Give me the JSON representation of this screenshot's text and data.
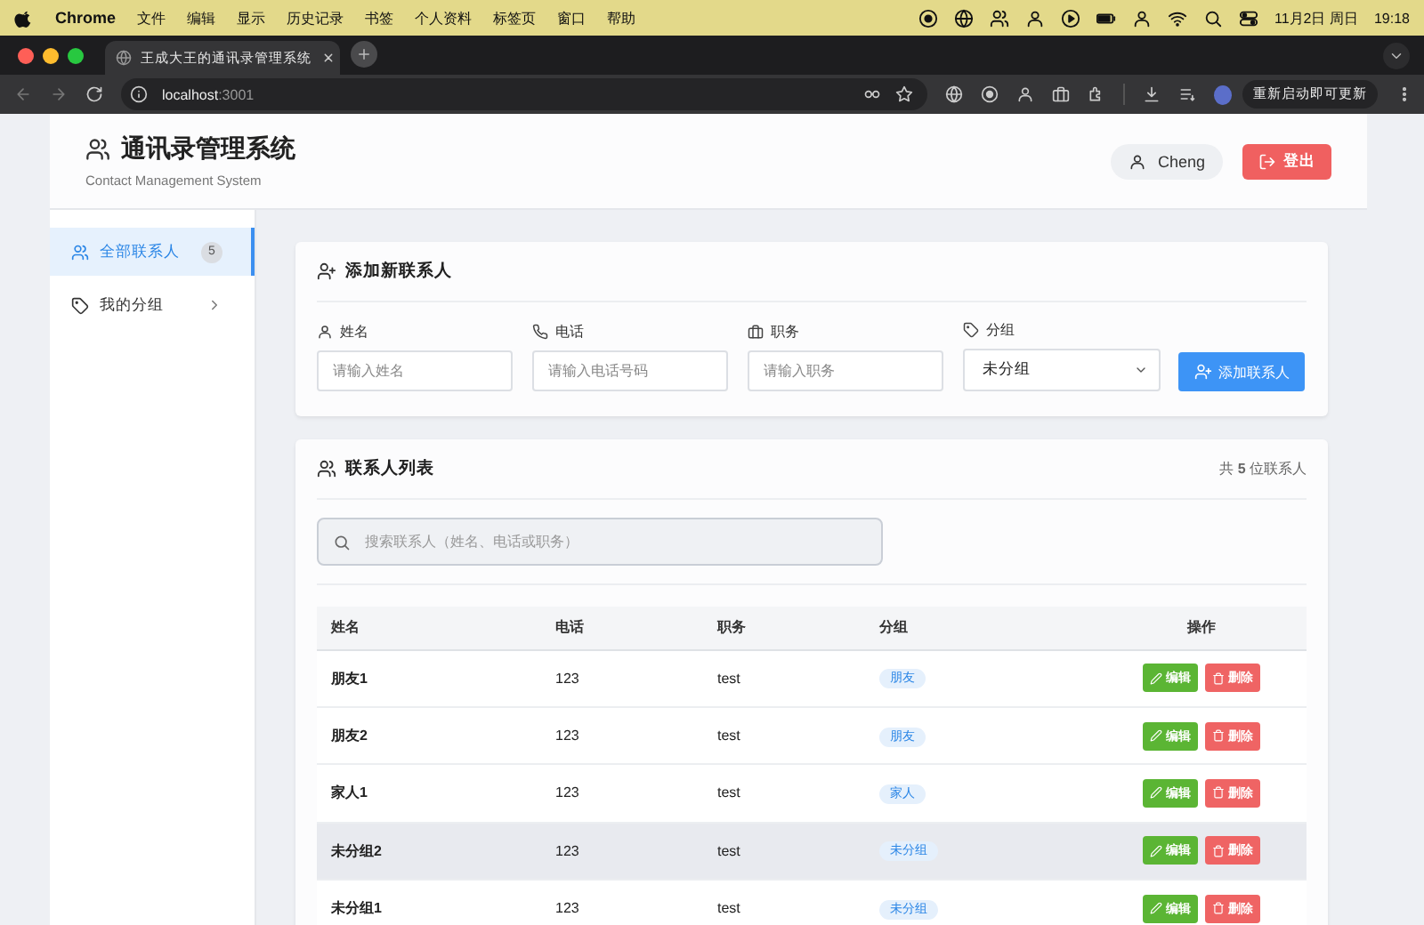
{
  "menu_bar": {
    "app": "Chrome",
    "items": [
      "文件",
      "编辑",
      "显示",
      "历史记录",
      "书签",
      "个人资料",
      "标签页",
      "窗口",
      "帮助"
    ],
    "date": "11月2日 周日",
    "time": "19:18"
  },
  "browser": {
    "tab_title": "王成大王的通讯录管理系统",
    "url_host": "localhost",
    "url_port": ":3001",
    "update_button": "重新启动即可更新"
  },
  "header": {
    "title": "通讯录管理系统",
    "subtitle": "Contact Management System",
    "user": "Cheng",
    "logout": "登出"
  },
  "sidebar": {
    "items": [
      {
        "label": "全部联系人",
        "badge": "5",
        "selected": true,
        "kind": "contacts"
      },
      {
        "label": "我的分组",
        "selected": false,
        "kind": "groups"
      }
    ]
  },
  "add_form": {
    "title": "添加新联系人",
    "fields": [
      {
        "kind": "name",
        "label": "姓名",
        "placeholder": "请输入姓名"
      },
      {
        "kind": "phone",
        "label": "电话",
        "placeholder": "请输入电话号码"
      },
      {
        "kind": "job",
        "label": "职务",
        "placeholder": "请输入职务"
      },
      {
        "kind": "group",
        "label": "分组",
        "value": "未分组"
      }
    ],
    "submit": "添加联系人"
  },
  "contact_list": {
    "title": "联系人列表",
    "count": "共 **5** 位联系人",
    "search": {
      "placeholder": "搜索联系人（姓名、电话或职务）"
    },
    "columns": [
      "姓名",
      "电话",
      "职务",
      "分组",
      "操作"
    ],
    "rows": [
      {
        "name": "朋友1",
        "phone": "123",
        "job": "test",
        "group": "朋友",
        "edit": "编辑",
        "delete": "删除",
        "highlighted": false
      },
      {
        "name": "朋友2",
        "phone": "123",
        "job": "test",
        "group": "朋友",
        "edit": "编辑",
        "delete": "删除",
        "highlighted": false
      },
      {
        "name": "家人1",
        "phone": "123",
        "job": "test",
        "group": "家人",
        "edit": "编辑",
        "delete": "删除",
        "highlighted": false
      },
      {
        "name": "未分组2",
        "phone": "123",
        "job": "test",
        "group": "未分组",
        "edit": "编辑",
        "delete": "删除",
        "highlighted": true
      },
      {
        "name": "未分组1",
        "phone": "123",
        "job": "test",
        "group": "未分组",
        "edit": "编辑",
        "delete": "删除",
        "highlighted": false
      }
    ]
  }
}
